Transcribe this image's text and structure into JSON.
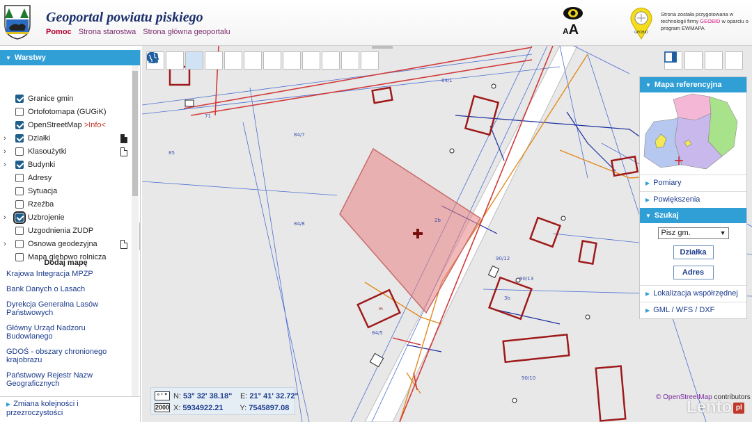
{
  "header": {
    "title": "Geoportal powiatu piskiego",
    "links": [
      "Pomoc",
      "Strona starostwa",
      "Strona główna geoportalu"
    ],
    "accessibility_text_size": {
      "small": "A",
      "big": "A"
    },
    "geobid_text_pre": "Strona została przygotowana w technologii firmy ",
    "geobid_brand": "GEOBID",
    "geobid_text_post": " w oparciu o program EWMAPA",
    "pin_label": "GEOBID"
  },
  "left_panel": {
    "layers_title": "Warstwy",
    "layers": [
      {
        "label": "Granice gmin",
        "checked": true,
        "expandable": false
      },
      {
        "label": "Ortofotomapa (GUGiK)",
        "checked": false,
        "expandable": false
      },
      {
        "label": "OpenStreetMap ",
        "info": ">Info<",
        "checked": true,
        "expandable": false
      },
      {
        "label": "Działki",
        "checked": true,
        "expandable": true
      },
      {
        "label": "Klasoużytki",
        "checked": false,
        "expandable": true
      },
      {
        "label": "Budynki",
        "checked": true,
        "expandable": true
      },
      {
        "label": "Adresy",
        "checked": false,
        "expandable": false
      },
      {
        "label": "Sytuacja",
        "checked": false,
        "expandable": false
      },
      {
        "label": "Rzeźba",
        "checked": false,
        "expandable": false
      },
      {
        "label": "Uzbrojenie",
        "checked": true,
        "expandable": true,
        "focused": true
      },
      {
        "label": "Uzgodnienia ZUDP",
        "checked": false,
        "expandable": false
      },
      {
        "label": "Osnowa geodezyjna",
        "checked": false,
        "expandable": true
      },
      {
        "label": "Mapa glebowo rolnicza",
        "checked": false,
        "expandable": false
      }
    ],
    "add_map_title": "Dodaj mapę",
    "add_map_links": [
      "Krajowa Integracja MPZP",
      "Bank Danych o Lasach",
      "Dyrekcja Generalna Lasów Państwowych",
      "Główny Urząd Nadzoru Budowlanego",
      "GDOŚ - obszary chronionego krajobrazu",
      "Państwowy Rejestr Nazw Geograficznych"
    ],
    "bottom_link": "Zmiana kolejności i przezroczystości"
  },
  "map": {
    "labels": [
      "84/1",
      "84/7",
      "85",
      "71",
      "84/8",
      "84/5",
      "2b",
      "3b",
      "90/10",
      "90/12",
      "90/13"
    ],
    "building_label": "m",
    "right_panel": {
      "ref_map_title": "Mapa referencyjna",
      "items_top": [
        "Pomiary",
        "Powiększenia"
      ],
      "search_title": "Szukaj",
      "search_select": "Pisz gm.",
      "search_buttons": [
        "Działka",
        "Adres"
      ],
      "items_bottom": [
        "Lokalizacja współrzędnej",
        "GML / WFS / DXF"
      ]
    },
    "coords": {
      "geo_tag": "° ' \"",
      "geo_n_label": "N:",
      "geo_n": "53° 32' 38.18\"",
      "geo_e_label": "E:",
      "geo_e": "21° 41' 32.72\"",
      "xy_tag": "2000",
      "x_label": "X:",
      "x": "5934922.21",
      "y_label": "Y:",
      "y": "7545897.08"
    },
    "credit_link": "© OpenStreetMap",
    "credit_text": " contributors",
    "watermark": "Lento",
    "watermark_badge": "pl"
  }
}
